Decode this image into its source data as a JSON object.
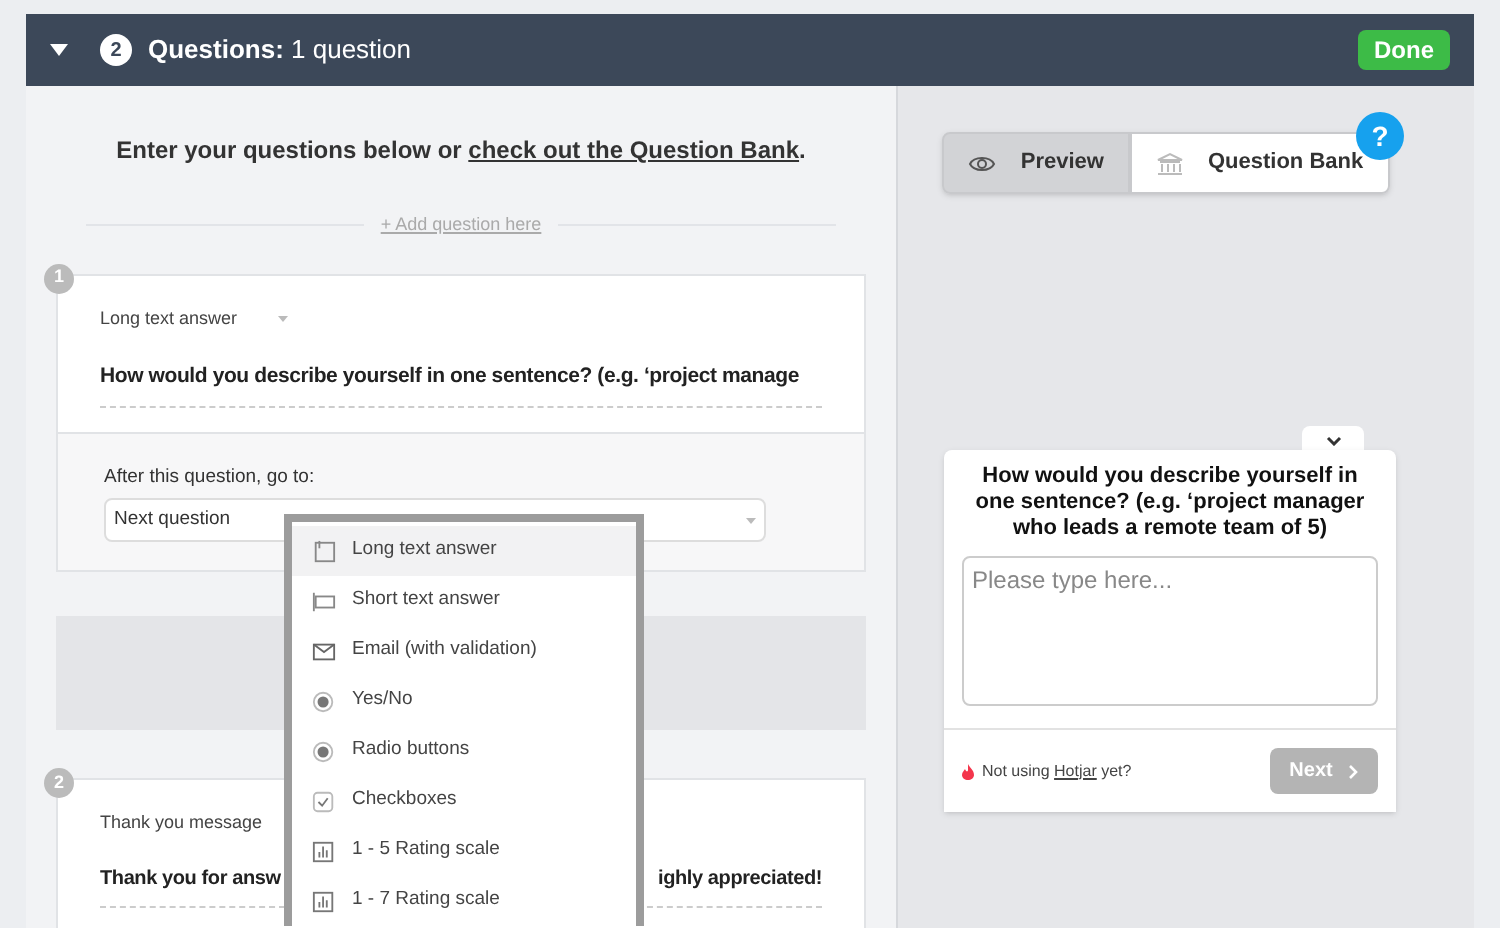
{
  "header": {
    "step": "2",
    "title": "**Questions:** 1 question",
    "done_button": "Done",
    "expanded": true
  },
  "intro": {
    "sentence": "Enter your questions below or ",
    "link": "check out the Question Bank",
    "end": "."
  },
  "add_question": "+ Add question here",
  "questions": [
    {
      "number": "1",
      "type": "Long text answer",
      "text": "How would you describe yourself in one sentence? (e.g. ‘project manage",
      "after_label": "After this question, go to:",
      "after_value": "Next question"
    },
    {
      "number": "2",
      "type": "Thank you message",
      "text_left": "Thank you for answ",
      "text_right": "ighly appreciated!"
    }
  ],
  "type_menu": [
    {
      "label": "Long text answer",
      "kind": "long",
      "selected": true
    },
    {
      "label": "Short text answer",
      "kind": "short",
      "selected": false
    },
    {
      "label": "Email (with validation)",
      "kind": "email",
      "selected": false
    },
    {
      "label": "Yes/No",
      "kind": "radio",
      "selected": false
    },
    {
      "label": "Radio buttons",
      "kind": "radio",
      "selected": false
    },
    {
      "label": "Checkboxes",
      "kind": "check",
      "selected": false
    },
    {
      "label": "1 - 5 Rating scale",
      "kind": "rating",
      "selected": false
    },
    {
      "label": "1 - 7 Rating scale",
      "kind": "rating",
      "selected": false
    }
  ],
  "view_tabs": [
    {
      "label": "Preview",
      "kind": "eye",
      "selected": true
    },
    {
      "label": "Question Bank",
      "kind": "bank",
      "selected": false
    }
  ],
  "help": "?",
  "preview": {
    "question": "How would you describe yourself in one sentence? (e.g. ‘project manager who leads a remote team of 5)",
    "placeholder": "Please type here...",
    "footer_text": "Not using ",
    "footer_link": "Hotjar",
    "footer_end": " yet?",
    "next_button": "Next",
    "next_disabled": true
  }
}
